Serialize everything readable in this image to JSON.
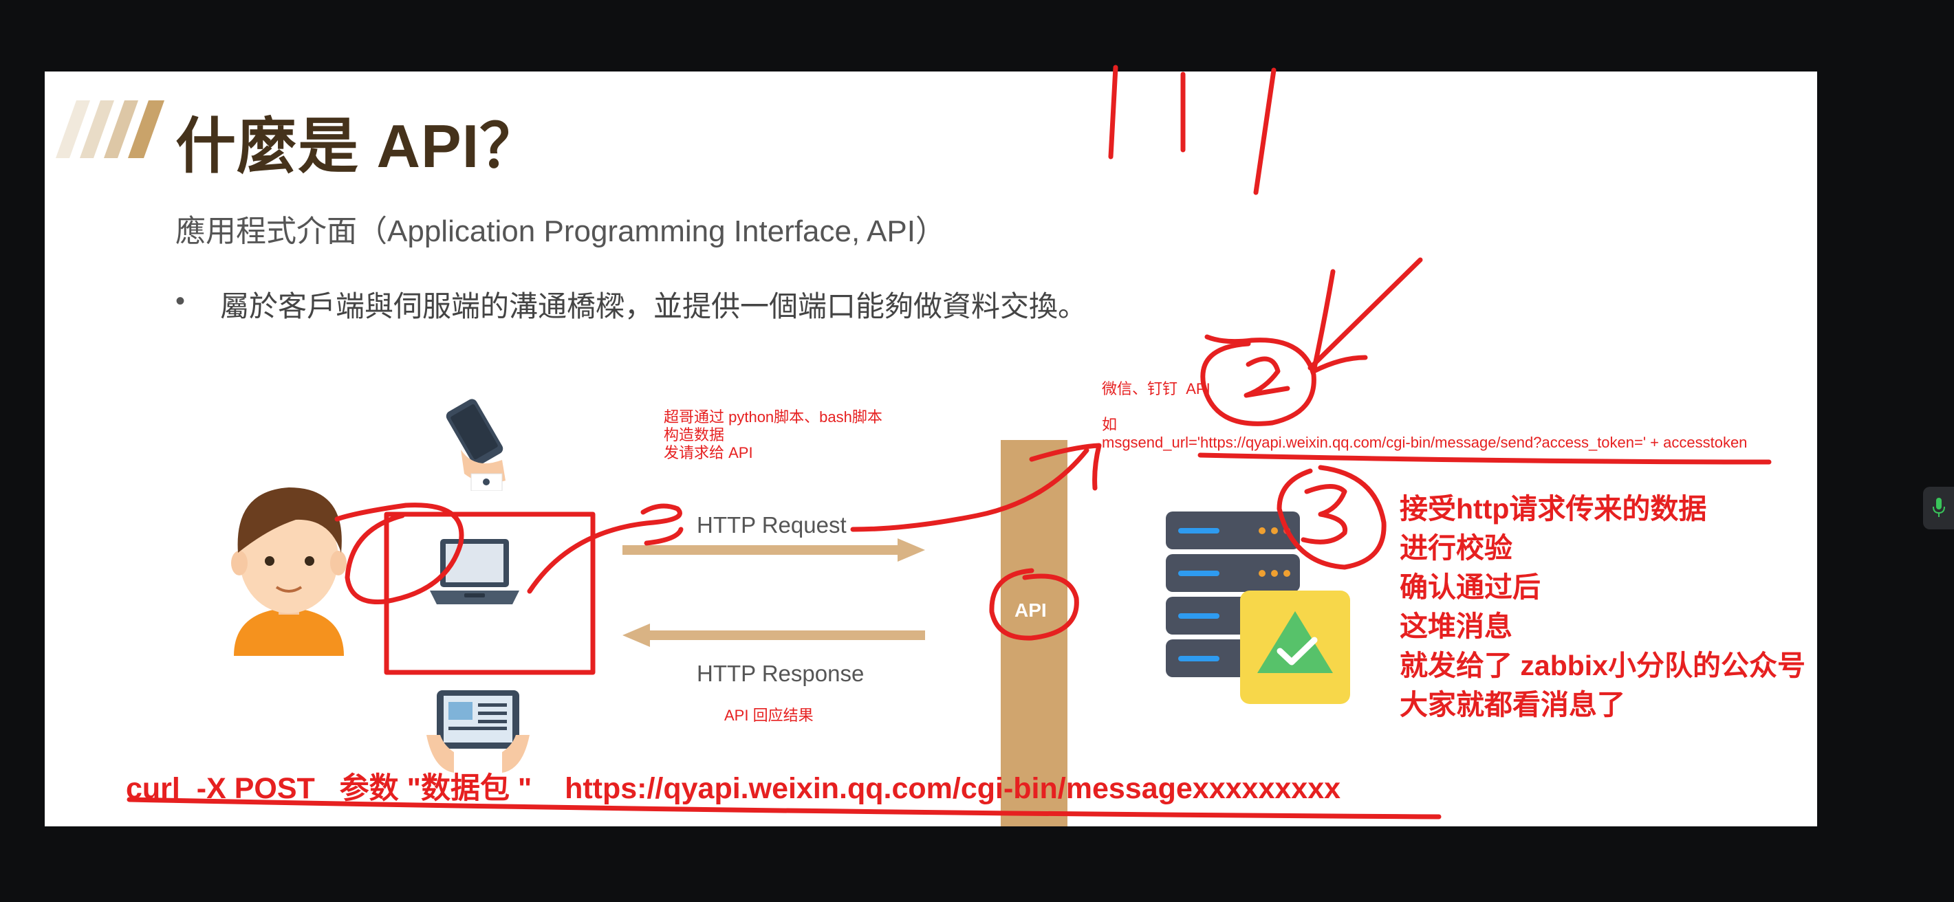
{
  "slide": {
    "title": "什麼是 API？",
    "subtitle": "應用程式介面（Application Programming Interface, API）",
    "bullet_symbol": "•",
    "bullet_text": "屬於客戶端與伺服端的溝通橋樑，並提供一個端口能夠做資料交換。"
  },
  "diagram": {
    "http_request": "HTTP Request",
    "http_response": "HTTP Response",
    "api": "API"
  },
  "annotations": {
    "script_note": "超哥通过 python脚本、bash脚本\n构造数据\n发请求给 API",
    "response_note": "API 回应结果",
    "wechat_line1": "微信、钉钉  API",
    "wechat_line2": "如",
    "wechat_url": "msgsend_url='https://qyapi.weixin.qq.com/cgi-bin/message/send?access_token=' + accesstoken",
    "steps": [
      "接受http请求传来的数据",
      "进行校验",
      "确认通过后",
      "这堆消息",
      "就发给了 zabbix小分队的公众号",
      "大家就都看消息了"
    ],
    "curl_command": "curl  -X POST   参数 \"数据包 \"    https://qyapi.weixin.qq.com/cgi-bin/messagexxxxxxxxx",
    "handwritten_numbers": [
      "1",
      "2",
      "3"
    ]
  },
  "colors": {
    "annotation_red": "#e62020",
    "title_brown": "#45321b",
    "api_bar": "#d0a56e",
    "arrow": "#d9b384"
  },
  "icons": [
    "person-icon",
    "phone-icon",
    "laptop-icon",
    "tablet-icon",
    "server-icon",
    "check-badge-icon",
    "microphone-icon"
  ]
}
